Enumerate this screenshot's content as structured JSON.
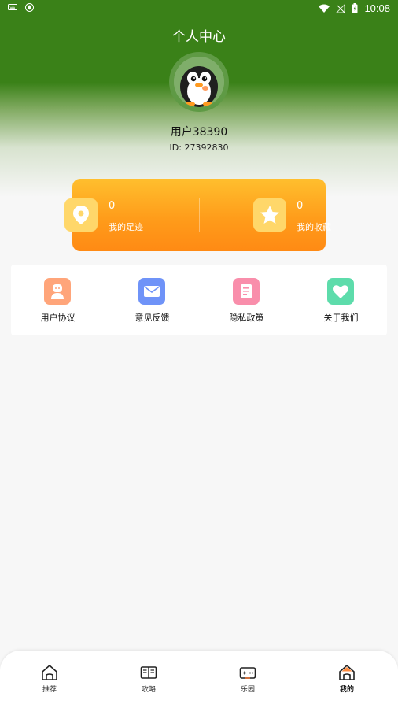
{
  "status_bar": {
    "time": "10:08",
    "icons": [
      "keyboard-icon",
      "shield-icon",
      "wifi-icon",
      "no-signal-icon",
      "battery-icon"
    ]
  },
  "header": {
    "title": "个人中心"
  },
  "profile": {
    "username": "用户38390",
    "user_id": "ID: 27392830",
    "avatar": "penguin-avatar"
  },
  "stats": [
    {
      "count": "0",
      "label": "我的足迹",
      "icon": "location-pin-icon"
    },
    {
      "count": "0",
      "label": "我的收藏",
      "icon": "star-icon"
    }
  ],
  "menu": [
    {
      "label": "用户协议",
      "icon": "user-agreement-icon",
      "color": "#ff9f6e"
    },
    {
      "label": "意见反馈",
      "icon": "envelope-icon",
      "color": "#6a8ff7"
    },
    {
      "label": "隐私政策",
      "icon": "document-icon",
      "color": "#f98aa7"
    },
    {
      "label": "关于我们",
      "icon": "heart-icon",
      "color": "#55d9a7"
    }
  ],
  "tabs": [
    {
      "label": "推荐",
      "icon": "home-icon",
      "active": false
    },
    {
      "label": "攻略",
      "icon": "book-icon",
      "active": false
    },
    {
      "label": "乐园",
      "icon": "gamepad-icon",
      "active": false
    },
    {
      "label": "我的",
      "icon": "profile-home-icon",
      "active": true
    }
  ],
  "colors": {
    "header_green": "#3a8118",
    "card_orange": "#ff9c1a",
    "accent_orange": "#ff8a14"
  }
}
